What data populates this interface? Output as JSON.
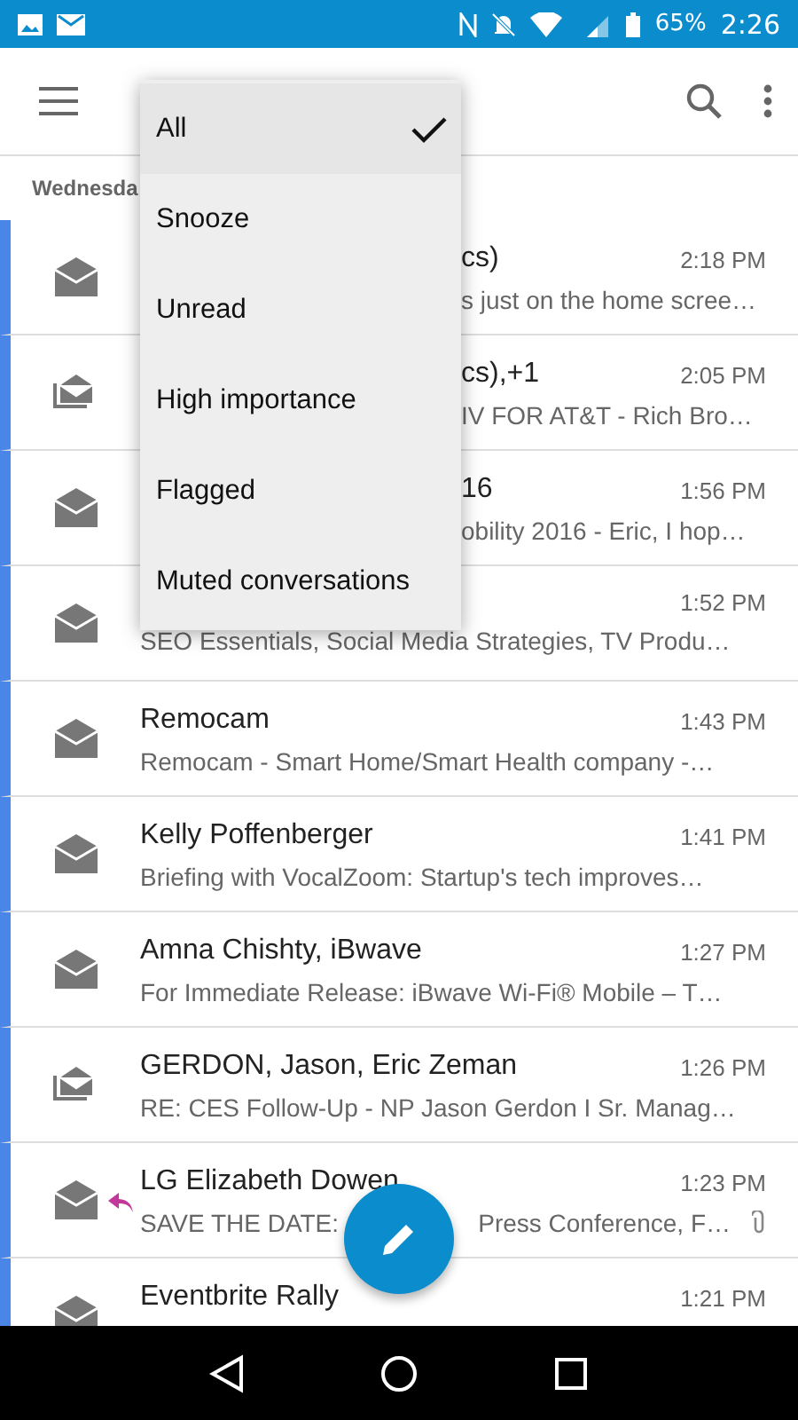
{
  "status_bar": {
    "battery": "65%",
    "time": "2:26"
  },
  "date_header": "Wednesda",
  "filter_menu": {
    "items": [
      {
        "label": "All",
        "selected": true
      },
      {
        "label": "Snooze",
        "selected": false
      },
      {
        "label": "Unread",
        "selected": false
      },
      {
        "label": "High importance",
        "selected": false
      },
      {
        "label": "Flagged",
        "selected": false
      },
      {
        "label": "Muted conversations",
        "selected": false
      }
    ]
  },
  "messages": [
    {
      "kind": "single",
      "covered": true,
      "sender": "cs)",
      "time": "2:18 PM",
      "preview": "s just on the home scree…",
      "replied": false,
      "attachment": false
    },
    {
      "kind": "thread",
      "covered": true,
      "sender": "cs),+1",
      "time": "2:05 PM",
      "preview": "IV FOR AT&T - Rich Bro…",
      "replied": false,
      "attachment": false
    },
    {
      "kind": "single",
      "covered": true,
      "sender": "16",
      "time": "1:56 PM",
      "preview": "obility 2016 - Eric, I hop…",
      "replied": false,
      "attachment": false
    },
    {
      "kind": "single",
      "covered": false,
      "time": "1:52 PM",
      "preview": "SEO Essentials, Social Media Strategies, TV Produ…",
      "replied": false,
      "attachment": false
    },
    {
      "kind": "single",
      "covered": false,
      "sender": "Remocam",
      "time": "1:43 PM",
      "preview": "Remocam - Smart Home/Smart Health company -…",
      "replied": false,
      "attachment": false
    },
    {
      "kind": "single",
      "covered": false,
      "sender": "Kelly Poffenberger",
      "time": "1:41 PM",
      "preview": "Briefing with VocalZoom: Startup's tech improves…",
      "replied": false,
      "attachment": false
    },
    {
      "kind": "single",
      "covered": false,
      "sender": "Amna Chishty, iBwave",
      "time": "1:27 PM",
      "preview": "For Immediate Release: iBwave Wi-Fi® Mobile – T…",
      "replied": false,
      "attachment": false
    },
    {
      "kind": "thread",
      "covered": false,
      "sender": "GERDON, Jason, Eric Zeman",
      "time": "1:26 PM",
      "preview": "RE: CES Follow-Up - NP Jason Gerdon I Sr. Manag…",
      "replied": false,
      "attachment": false
    },
    {
      "kind": "single",
      "covered": false,
      "sender": "LG Elizabeth Dowen",
      "time": "1:23 PM",
      "preview": "SAVE THE DATE:",
      "preview_tail": "Press Conference, F…",
      "replied": true,
      "attachment": true
    },
    {
      "kind": "single",
      "covered": false,
      "sender": "Eventbrite Rally",
      "time": "1:21 PM",
      "replied": false,
      "attachment": false
    }
  ]
}
